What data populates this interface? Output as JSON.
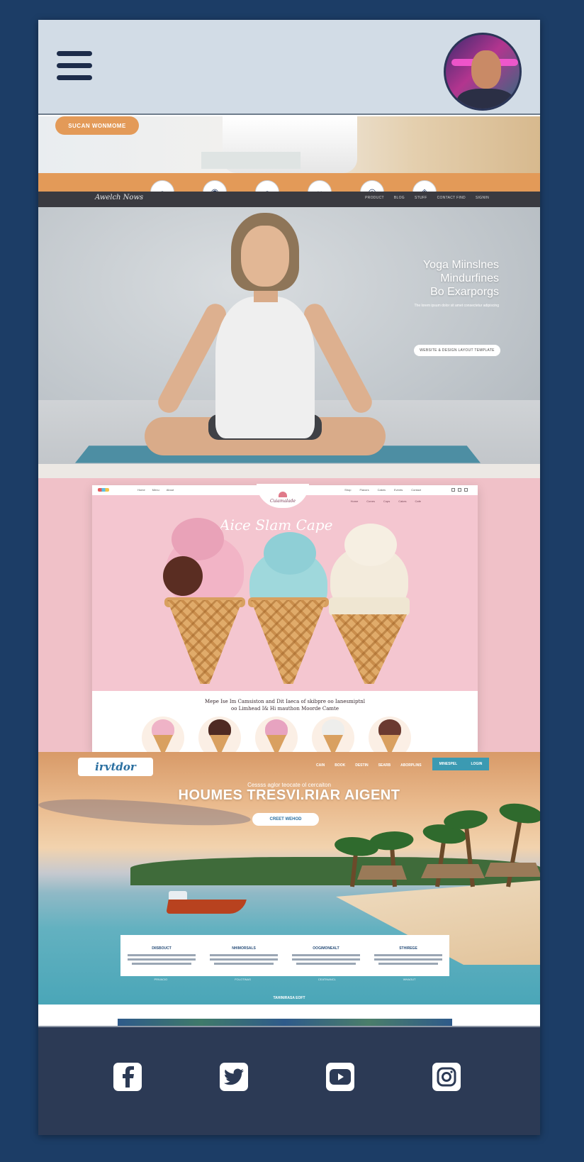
{
  "header": {
    "menu_icon": "hamburger-menu-icon",
    "avatar_icon": "user-avatar"
  },
  "vet_section": {
    "button_label": "SUCAN WONMOME",
    "service_icons": [
      "pet-icon",
      "dog-icon",
      "cat-icon",
      "syringe-icon",
      "stethoscope-icon",
      "paw-icon"
    ],
    "logo_text": "Awelch Nows",
    "nav_links": [
      "PRODUCT",
      "BLOG",
      "STUFF",
      "CONTACT FIND",
      "SIGNIN"
    ]
  },
  "yoga_section": {
    "title_lines": [
      "Yoga Miinslnes",
      "Mindurfines",
      "Bo Exarporgs"
    ],
    "subtitle": "The lorem ipsum dolor sit amet consectetur adipiscing",
    "button_label": "WEBSITE & DESIGN LAYOUT TEMPLATE"
  },
  "icecream_section": {
    "nav_left": [
      "Home",
      "Menu",
      "About"
    ],
    "nav_right": [
      "Shop",
      "Flavors",
      "Cakes",
      "Events",
      "Contact"
    ],
    "logo_text": "Cuiamalade",
    "sub_nav": [
      "Home",
      "Cones",
      "Cups",
      "Cakes",
      "Cafe"
    ],
    "title": "Aice Slam Cape",
    "text_line1": "Mepe Ise Im Camsiston and Dit Iaeca of skibpre oo Ianesmiptnl",
    "text_line2": "oo Limhead I& Hi mauthon Moorde Camte",
    "colors": {
      "pink": "#f4c6d0",
      "mint": "#9fd8dc",
      "chocolate": "#5a2d22",
      "cream": "#f3ebdc",
      "waffle": "#d9a060"
    }
  },
  "travel_section": {
    "logo_text": "irvtdor",
    "nav_links": [
      "CAIN",
      "BOOK",
      "DESTIN",
      "SEARB",
      "ABORPLINS"
    ],
    "cta_labels": [
      "MINESPEL",
      "LOGIN"
    ],
    "kicker": "Cessss aglor teocate ol cercaiton",
    "title": "HOUMES TRESVI.RIAR AIGENT",
    "button_label": "CREET WEHOD",
    "cards": [
      {
        "title": "DIISBOUCT"
      },
      {
        "title": "NHIMORSALS"
      },
      {
        "title": "OOGIMONEALT"
      },
      {
        "title": "STHIREGE"
      }
    ],
    "links": [
      "PRIVACIO",
      "FOLOTINAS",
      "CEATINANCL",
      "WHAOUT"
    ],
    "footer_text": "TAHINIRASA EOFT"
  },
  "footer": {
    "social_icons": [
      "facebook-icon",
      "twitter-icon",
      "youtube-icon",
      "instagram-icon"
    ],
    "accent": "#2c3a55"
  }
}
